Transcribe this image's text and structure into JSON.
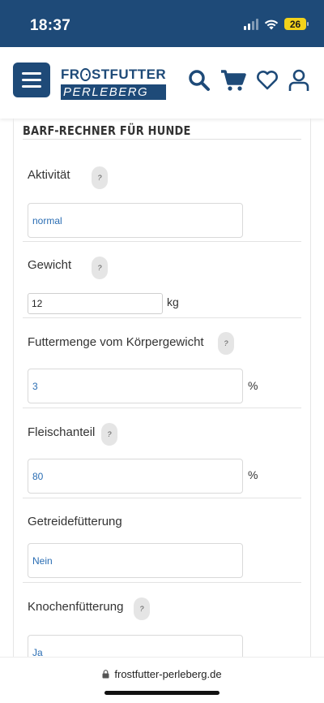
{
  "status_bar": {
    "time": "18:37",
    "battery": "26"
  },
  "header": {
    "logo_line1_a": "FR",
    "logo_line1_b": "STFUTTER",
    "logo_line2": "PERLEBERG"
  },
  "form": {
    "title": "BARF-Rechner für Hunde",
    "help_glyph": "?",
    "fields": [
      {
        "label": "Aktivität",
        "value": "normal"
      },
      {
        "label": "Gewicht",
        "value": "12",
        "unit": "kg"
      },
      {
        "label": "Futtermenge vom Körpergewicht",
        "value": "3",
        "unit": "%"
      },
      {
        "label": "Fleischanteil",
        "value": "80",
        "unit": "%"
      },
      {
        "label": "Getreidefütterung",
        "value": "Nein"
      },
      {
        "label": "Knochenfütterung",
        "value": "Ja"
      }
    ]
  },
  "browser": {
    "url": "frostfutter-perleberg.de"
  },
  "colors": {
    "brand": "#1e4a78",
    "value_text": "#2a6db3",
    "battery": "#f2d21a"
  }
}
